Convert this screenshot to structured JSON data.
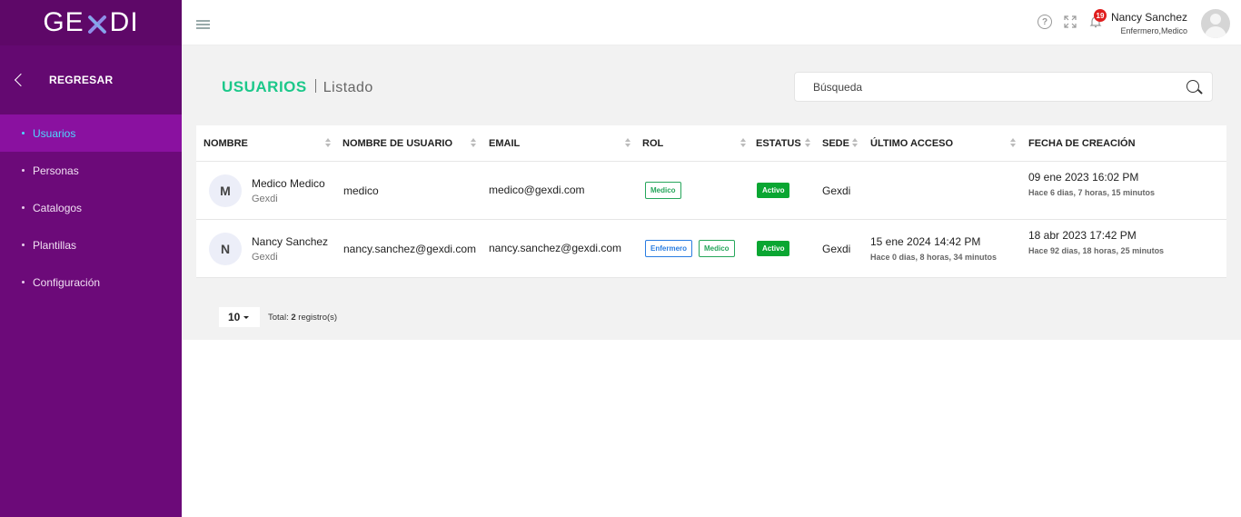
{
  "brand": {
    "logo_left": "GE",
    "logo_right": "DI"
  },
  "sidebar": {
    "back_label": "REGRESAR",
    "items": [
      {
        "label": "Usuarios",
        "active": true
      },
      {
        "label": "Personas"
      },
      {
        "label": "Catalogos"
      },
      {
        "label": "Plantillas"
      },
      {
        "label": "Configuración"
      }
    ]
  },
  "topbar": {
    "notifications_count": "19",
    "user_name": "Nancy Sanchez",
    "user_roles": "Enfermero,Medico"
  },
  "page": {
    "title": "USUARIOS",
    "subtitle": "Listado"
  },
  "search": {
    "placeholder": "Búsqueda"
  },
  "table": {
    "headers": [
      "NOMBRE",
      "NOMBRE DE USUARIO",
      "EMAIL",
      "ROL",
      "ESTATUS",
      "SEDE",
      "ÚLTIMO ACCESO",
      "FECHA DE CREACIÓN"
    ],
    "rows": [
      {
        "initial": "M",
        "name": "Medico Medico",
        "org": "Gexdi",
        "username": "medico",
        "email": "medico@gexdi.com",
        "roles": [
          "Medico"
        ],
        "status": "Activo",
        "site": "Gexdi",
        "last_access": "",
        "last_access_rel": "",
        "created": "09 ene 2023 16:02 PM",
        "created_rel": "Hace 6 dias, 7 horas, 15 minutos"
      },
      {
        "initial": "N",
        "name": "Nancy Sanchez",
        "org": "Gexdi",
        "username": "nancy.sanchez@gexdi.com",
        "email": "nancy.sanchez@gexdi.com",
        "roles": [
          "Enfermero",
          "Medico"
        ],
        "status": "Activo",
        "site": "Gexdi",
        "last_access": "15 ene 2024 14:42 PM",
        "last_access_rel": "Hace 0 dias, 8 horas, 34 minutos",
        "created": "18 abr 2023 17:42 PM",
        "created_rel": "Hace 92 dias, 18 horas, 25 minutos"
      }
    ]
  },
  "footer": {
    "page_size": "10",
    "total_label": "Total:",
    "total_count": "2",
    "total_suffix": "registro(s)"
  },
  "colors": {
    "sidebar": "#6c0a79",
    "accent": "#1cc88a",
    "active_link": "#4dd9ff",
    "status_active": "#0aa632"
  }
}
